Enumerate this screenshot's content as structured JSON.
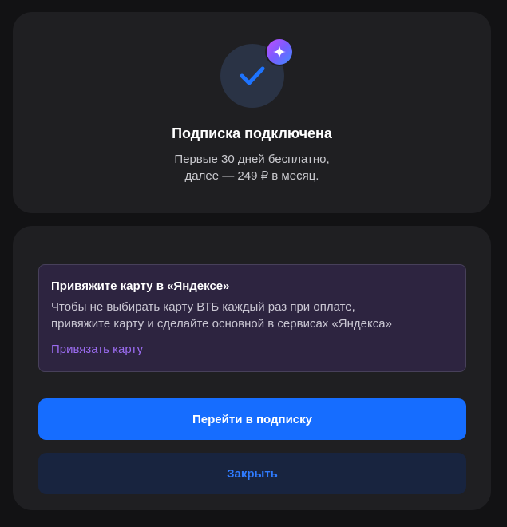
{
  "status": {
    "title": "Подписка подключена",
    "subtitle_line1": "Первые 30 дней бесплатно,",
    "subtitle_line2": "далее — 249 ₽ в месяц."
  },
  "icons": {
    "status_icon": "checkmark-icon",
    "badge_icon": "sparkle-icon"
  },
  "notice": {
    "title": "Привяжите карту в «Яндексе»",
    "text_line1": "Чтобы не выбирать карту ВТБ каждый раз при оплате,",
    "text_line2": "привяжите карту и сделайте основной в сервисах «Яндекса»",
    "link_label": "Привязать карту"
  },
  "actions": {
    "primary_label": "Перейти в подписку",
    "secondary_label": "Закрыть"
  },
  "colors": {
    "accent": "#166dff",
    "link": "#9b6cf0",
    "background": "#121214",
    "card": "#1f1f22"
  }
}
